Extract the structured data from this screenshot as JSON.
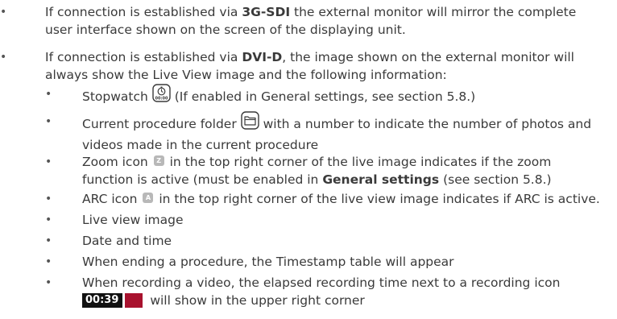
{
  "items": [
    {
      "text_before": "If connection is established via ",
      "bold": "3G-SDI",
      "text_after": " the external monitor will mirror the complete",
      "line2": "user interface shown on the screen of the displaying unit."
    },
    {
      "text_before": "If connection is established via ",
      "bold": "DVI-D",
      "text_after": ", the image shown on the external monitor will",
      "line2": "always show the Live View image and the following information:"
    }
  ],
  "subitems": {
    "stopwatch": {
      "before": "Stopwatch",
      "after": "(If enabled in General settings, see section 5.8.)"
    },
    "procedure_folder": {
      "before": "Current procedure folder",
      "after": "with a number to indicate the number of photos and",
      "line2": "videos made in the current procedure"
    },
    "zoom": {
      "before": "Zoom icon",
      "icon_letter": "Z",
      "after": "in the top right corner of the live image indicates if the zoom",
      "line2_before": "function is active (must be enabled in ",
      "line2_bold": "General settings",
      "line2_after": " (see section 5.8.)"
    },
    "arc": {
      "before": "ARC icon",
      "icon_letter": "A",
      "after": "in the top right corner of the live view image indicates if ARC is active."
    },
    "live_view": "Live view image",
    "date_time": "Date and time",
    "timestamp": "When ending a procedure, the Timestamp table will appear",
    "recording": {
      "line1": "When recording a video, the elapsed recording time next to a recording icon",
      "time": "00:39",
      "after": "will show in the upper right corner"
    }
  },
  "icons": {
    "stopwatch": "stopwatch-icon",
    "folder": "folder-icon",
    "zoom": "zoom-icon",
    "arc": "arc-icon",
    "record": "record-icon"
  },
  "colors": {
    "text": "#3a3a3a",
    "icon_grey": "#b8b8b8",
    "record_red": "#a8122e",
    "record_time_bg": "#111111"
  }
}
